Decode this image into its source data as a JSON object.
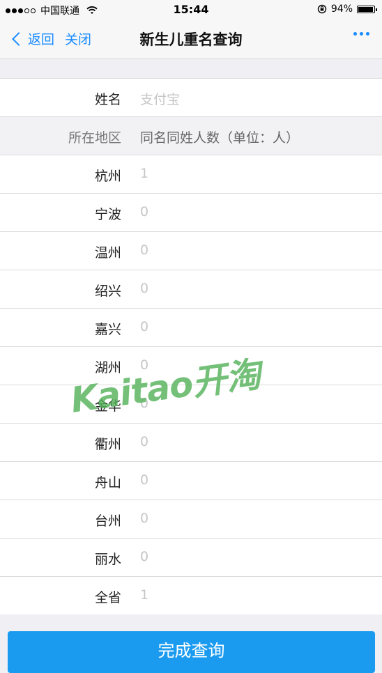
{
  "status_bar": {
    "carrier": "中国联通",
    "time": "15:44",
    "battery": "94%",
    "battery_level": 0.94
  },
  "navbar": {
    "back_label": "返回",
    "close_label": "关闭",
    "title": "新生儿重名查询"
  },
  "form": {
    "name_label": "姓名",
    "name_placeholder": "支付宝"
  },
  "table": {
    "header": {
      "label": "所在地区",
      "value": "同名同姓人数（单位：人）"
    },
    "rows": [
      {
        "label": "杭州",
        "value": "1"
      },
      {
        "label": "宁波",
        "value": "0"
      },
      {
        "label": "温州",
        "value": "0"
      },
      {
        "label": "绍兴",
        "value": "0"
      },
      {
        "label": "嘉兴",
        "value": "0"
      },
      {
        "label": "湖州",
        "value": "0"
      },
      {
        "label": "金华",
        "value": "0"
      },
      {
        "label": "衢州",
        "value": "0"
      },
      {
        "label": "舟山",
        "value": "0"
      },
      {
        "label": "台州",
        "value": "0"
      },
      {
        "label": "丽水",
        "value": "0"
      },
      {
        "label": "全省",
        "value": "1"
      }
    ]
  },
  "watermark": "Kaitao开淘",
  "submit_label": "完成查询",
  "colors": {
    "accent": "#1a8cff",
    "button": "#1a9bf0"
  },
  "icons": [
    "signal-dots-icon",
    "wifi-icon",
    "orientation-lock-icon",
    "battery-icon",
    "chevron-left-icon",
    "more-dots-icon"
  ]
}
